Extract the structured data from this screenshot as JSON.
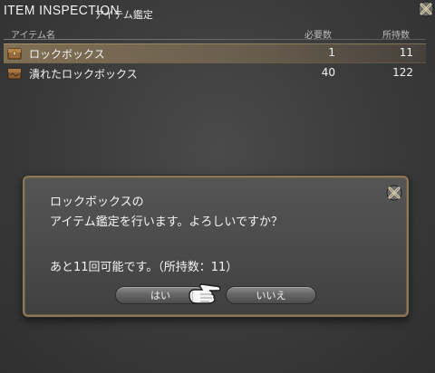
{
  "window": {
    "title": "ITEM INSPECTION",
    "subtitle": "アイテム鑑定",
    "close_icon": "gear-close-icon"
  },
  "table": {
    "columns": [
      "アイテム名",
      "必要数",
      "所持数"
    ],
    "rows": [
      {
        "name": "ロックボックス",
        "required": "1",
        "owned": "11",
        "selected": true,
        "icon": "lockbox-icon"
      },
      {
        "name": "潰れたロックボックス",
        "required": "40",
        "owned": "122",
        "selected": false,
        "icon": "lockbox-icon"
      }
    ]
  },
  "dialog": {
    "line1": "ロックボックスの",
    "line2": "アイテム鑑定を行います。よろしいですか？",
    "line3": "あと11回可能です。（所持数：11）",
    "yes_label": "はい",
    "no_label": "いいえ",
    "close_icon": "gear-close-icon",
    "cursor_icon": "pointing-hand-cursor-icon"
  },
  "colors": {
    "background": "#3a3a3a",
    "selection": "#b49a6e",
    "dialog_border": "#8a7858",
    "text": "#f2f2f2"
  }
}
